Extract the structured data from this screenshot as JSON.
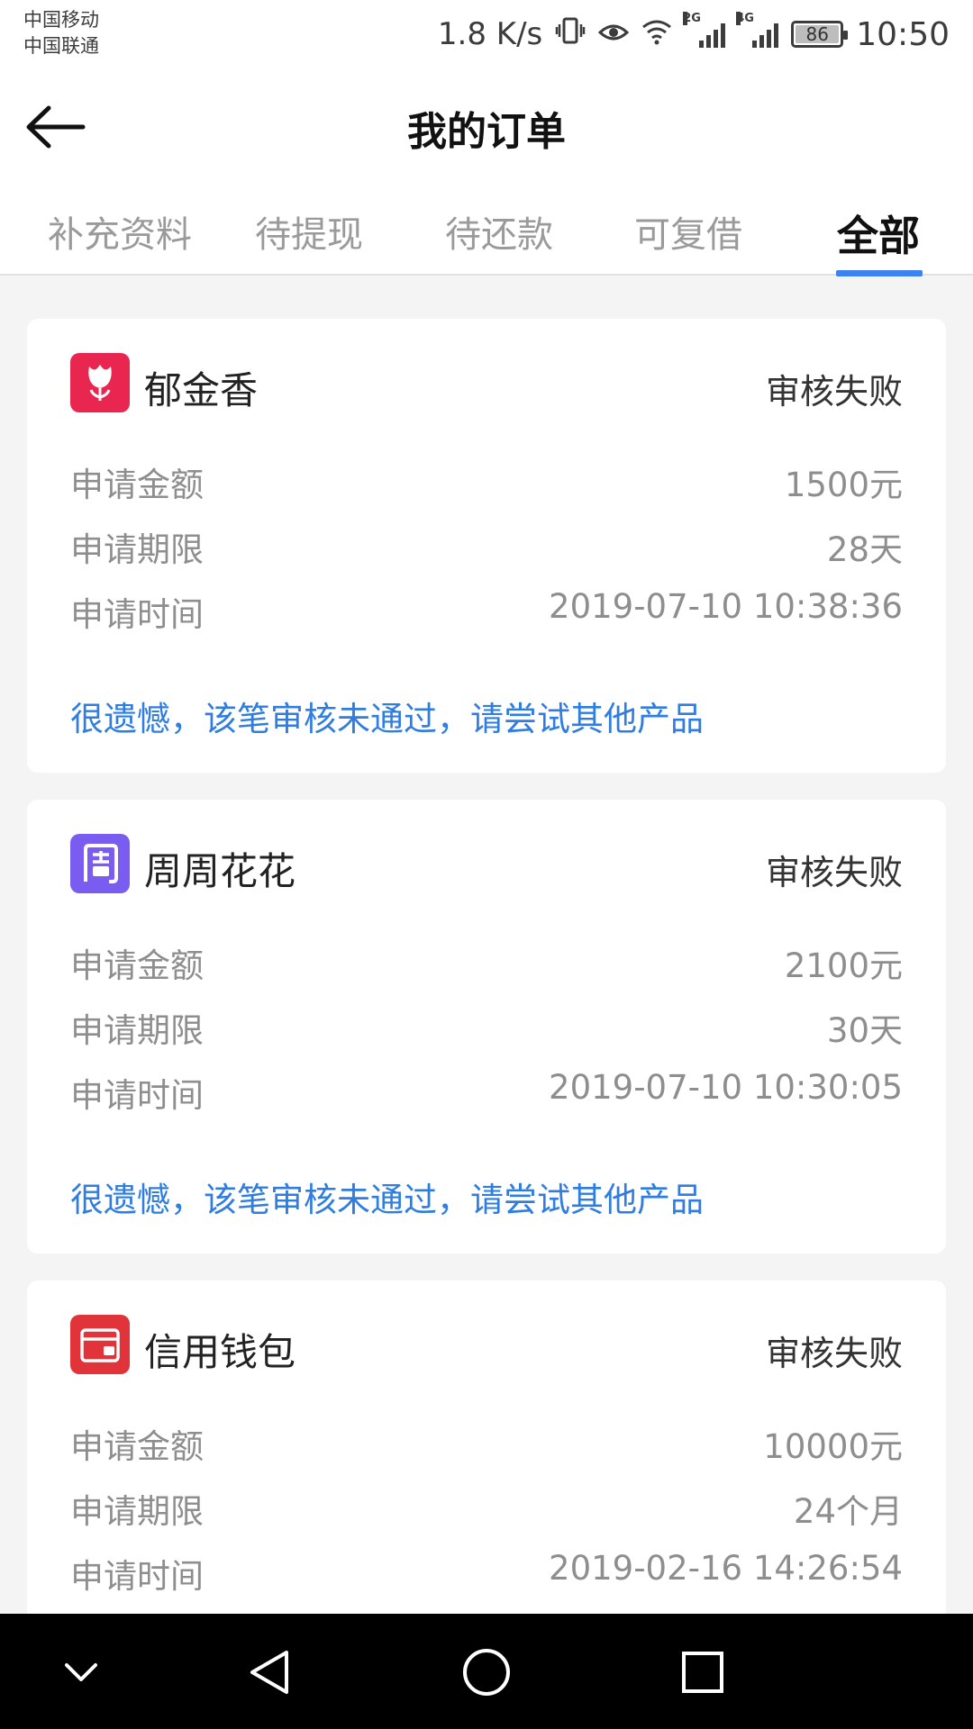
{
  "status_bar": {
    "carrier_1": "中国移动",
    "carrier_2": "中国联通",
    "speed": "1.8 K/s",
    "net_2g": "2G",
    "net_4g": "4G",
    "battery": "86",
    "time": "10:50"
  },
  "header": {
    "title": "我的订单"
  },
  "tabs": [
    {
      "label": "补充资料"
    },
    {
      "label": "待提现"
    },
    {
      "label": "待还款"
    },
    {
      "label": "可复借"
    },
    {
      "label": "全部"
    }
  ],
  "active_tab": "全部",
  "orders": [
    {
      "name": "郁金香",
      "status": "审核失败",
      "logo_icon": "tulip-icon",
      "logo_color": "#e8264f",
      "amount_label": "申请金额",
      "amount": "1500元",
      "term_label": "申请期限",
      "term": "28天",
      "time_label": "申请时间",
      "time": "2019-07-10 10:38:36",
      "note": "很遗憾，该笔审核未通过，请尝试其他产品"
    },
    {
      "name": "周周花花",
      "status": "审核失败",
      "logo_icon": "zhou-icon",
      "logo_color": "#7b5cf0",
      "amount_label": "申请金额",
      "amount": "2100元",
      "term_label": "申请期限",
      "term": "30天",
      "time_label": "申请时间",
      "time": "2019-07-10 10:30:05",
      "note": "很遗憾，该笔审核未通过，请尝试其他产品"
    },
    {
      "name": "信用钱包",
      "status": "审核失败",
      "logo_icon": "wallet-icon",
      "logo_color": "#e0343a",
      "amount_label": "申请金额",
      "amount": "10000元",
      "term_label": "申请期限",
      "term": "24个月",
      "time_label": "申请时间",
      "time": "2019-02-16 14:26:54"
    }
  ],
  "colors": {
    "accent": "#3c82f0",
    "note_text": "#2f7de1",
    "muted_text": "#8e8e8e"
  }
}
